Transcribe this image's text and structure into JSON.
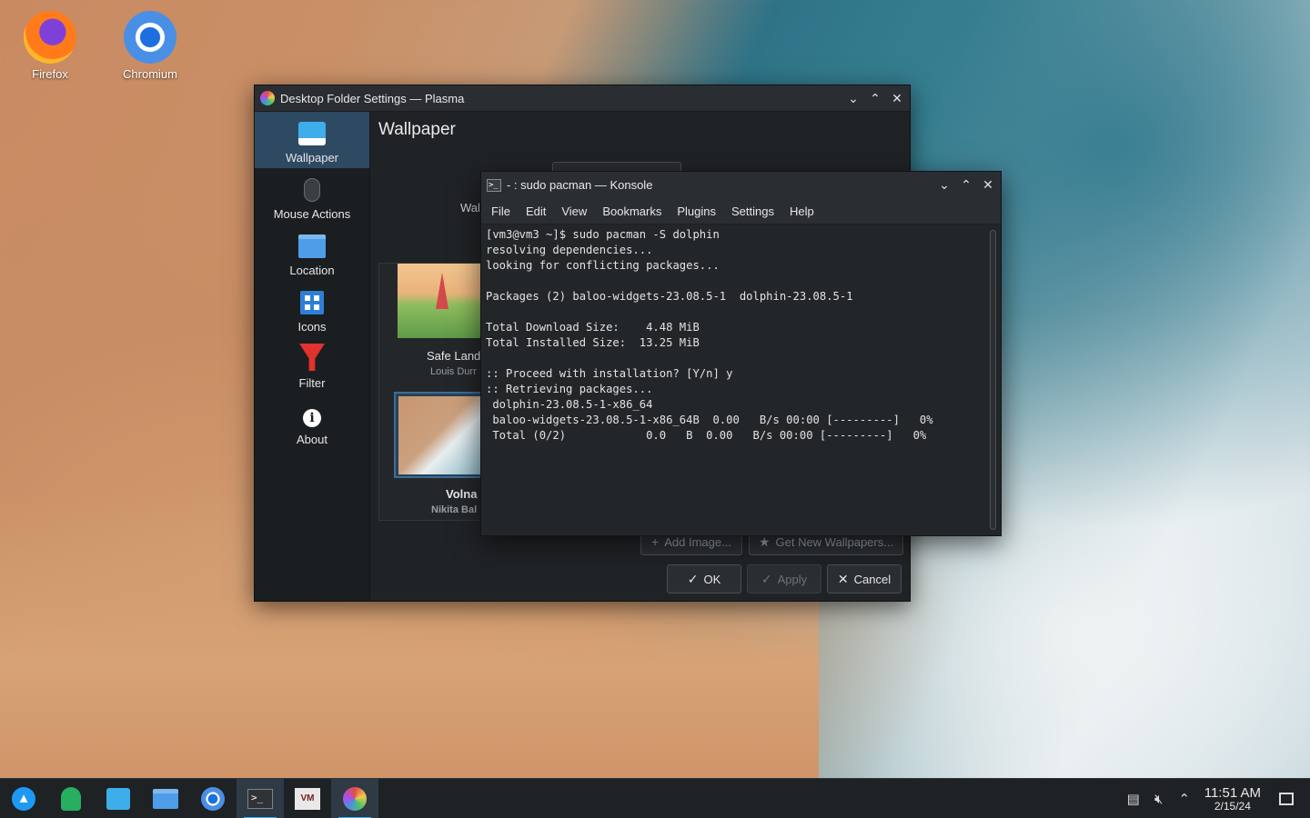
{
  "desktop": {
    "icons": [
      {
        "label": "Firefox",
        "icon": "firefox-icon"
      },
      {
        "label": "Chromium",
        "icon": "chromium-icon"
      }
    ]
  },
  "settings_window": {
    "title": "Desktop Folder Settings — Plasma",
    "sidebar": [
      {
        "label": "Wallpaper",
        "icon": "wallpaper-icon",
        "active": true
      },
      {
        "label": "Mouse Actions",
        "icon": "mouse-icon"
      },
      {
        "label": "Location",
        "icon": "folder-icon"
      },
      {
        "label": "Icons",
        "icon": "icons-grid-icon"
      },
      {
        "label": "Filter",
        "icon": "filter-icon"
      },
      {
        "label": "About",
        "icon": "info-icon"
      }
    ],
    "page_title": "Wallpaper",
    "wallpaper_label_partial": "Wal",
    "thumbnails": [
      {
        "title": "Safe Land",
        "author": "Louis Durr"
      },
      {
        "title": "Volna",
        "author": "Nikita Bal"
      }
    ],
    "add_image": "Add Image...",
    "get_new": "Get New Wallpapers...",
    "ok": "OK",
    "apply": "Apply",
    "cancel": "Cancel"
  },
  "konsole": {
    "title": "- : sudo pacman — Konsole",
    "menu": [
      "File",
      "Edit",
      "View",
      "Bookmarks",
      "Plugins",
      "Settings",
      "Help"
    ],
    "lines": [
      "[vm3@vm3 ~]$ sudo pacman -S dolphin",
      "resolving dependencies...",
      "looking for conflicting packages...",
      "",
      "Packages (2) baloo-widgets-23.08.5-1  dolphin-23.08.5-1",
      "",
      "Total Download Size:    4.48 MiB",
      "Total Installed Size:  13.25 MiB",
      "",
      ":: Proceed with installation? [Y/n] y",
      ":: Retrieving packages...",
      " dolphin-23.08.5-1-x86_64",
      " baloo-widgets-23.08.5-1-x86_64B  0.00   B/s 00:00 [---------]   0%",
      " Total (0/2)            0.0   B  0.00   B/s 00:00 [---------]   0%"
    ]
  },
  "taskbar": {
    "apps": [
      "launcher-icon",
      "wrench-icon",
      "discover-icon",
      "dolphin-folder-icon",
      "chromium-icon",
      "konsole-icon",
      "virt-manager-icon",
      "system-settings-icon"
    ],
    "clock_time": "11:51 AM",
    "clock_date": "2/15/24"
  }
}
